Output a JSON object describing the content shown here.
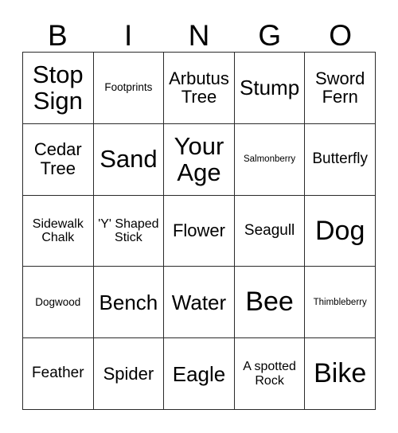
{
  "card": {
    "title": "BINGO",
    "header_letters": [
      "B",
      "I",
      "N",
      "G",
      "O"
    ],
    "columns": 5,
    "rows": 5,
    "background_color": "#ffffff",
    "text_color": "#000000",
    "border_color": "#2b2b2b",
    "cells": [
      {
        "label": "Stop Sign",
        "size": "sz-xl"
      },
      {
        "label": "Footprints",
        "size": "sz-xxs"
      },
      {
        "label": "Arbutus Tree",
        "size": "sz-md"
      },
      {
        "label": "Stump",
        "size": "sz-lg"
      },
      {
        "label": "Sword Fern",
        "size": "sz-md"
      },
      {
        "label": "Cedar Tree",
        "size": "sz-md"
      },
      {
        "label": "Sand",
        "size": "sz-xl"
      },
      {
        "label": "Your Age",
        "size": "sz-xl"
      },
      {
        "label": "Salmonberry",
        "size": "sz-tiny"
      },
      {
        "label": "Butterfly",
        "size": "sz-sm"
      },
      {
        "label": "Sidewalk Chalk",
        "size": "sz-xs"
      },
      {
        "label": "'Y' Shaped Stick",
        "size": "sz-xs"
      },
      {
        "label": "Flower",
        "size": "sz-md"
      },
      {
        "label": "Seagull",
        "size": "sz-sm"
      },
      {
        "label": "Dog",
        "size": "sz-xxl"
      },
      {
        "label": "Dogwood",
        "size": "sz-xxs"
      },
      {
        "label": "Bench",
        "size": "sz-lg"
      },
      {
        "label": "Water",
        "size": "sz-lg"
      },
      {
        "label": "Bee",
        "size": "sz-xxl"
      },
      {
        "label": "Thimbleberry",
        "size": "sz-tiny"
      },
      {
        "label": "Feather",
        "size": "sz-sm"
      },
      {
        "label": "Spider",
        "size": "sz-md"
      },
      {
        "label": "Eagle",
        "size": "sz-lg"
      },
      {
        "label": "A spotted Rock",
        "size": "sz-xs"
      },
      {
        "label": "Bike",
        "size": "sz-xxl"
      }
    ]
  }
}
